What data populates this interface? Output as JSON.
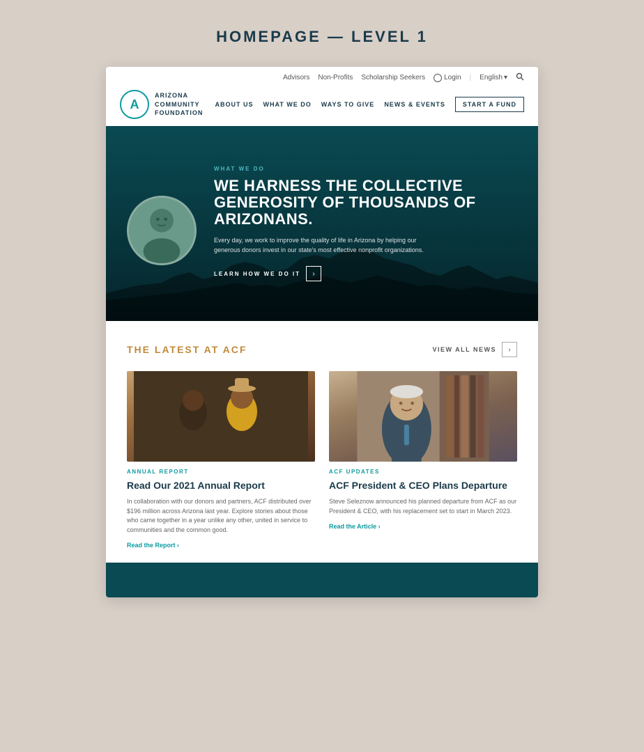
{
  "page": {
    "title": "HOMEPAGE — LEVEL 1"
  },
  "header": {
    "top_links": [
      "Advisors",
      "Non-Profits",
      "Scholarship Seekers"
    ],
    "login_label": "Login",
    "language_label": "English",
    "logo_letter": "A",
    "logo_line1": "ARIZONA",
    "logo_line2": "COMMUNITY",
    "logo_line3": "FOUNDATION",
    "nav_items": [
      "About Us",
      "What We Do",
      "Ways to Give",
      "News & Events"
    ],
    "start_fund_label": "Start a Fund"
  },
  "hero": {
    "label": "What We Do",
    "title": "WE HARNESS THE COLLECTIVE GENEROSITY OF THOUSANDS OF ARIZONANS.",
    "description": "Every day, we work to improve the quality of life in Arizona by helping our generous donors invest in our state's most effective nonprofit organizations.",
    "cta_label": "LEARN HOW WE DO IT"
  },
  "latest": {
    "section_title": "THE LATEST AT ACF",
    "view_all_label": "VIEW ALL NEWS",
    "cards": [
      {
        "category": "Annual Report",
        "title": "Read Our 2021 Annual Report",
        "description": "In collaboration with our donors and partners, ACF distributed over $196 million across Arizona last year. Explore stories about those who came together in a year unlike any other, united in service to communities and the common good.",
        "cta": "Read the Report ›"
      },
      {
        "category": "ACF Updates",
        "title": "ACF President & CEO Plans Departure",
        "description": "Steve Seleznow announced his planned departure from ACF as our President & CEO, with his replacement set to start in March 2023.",
        "cta": "Read the Article ›"
      }
    ]
  }
}
